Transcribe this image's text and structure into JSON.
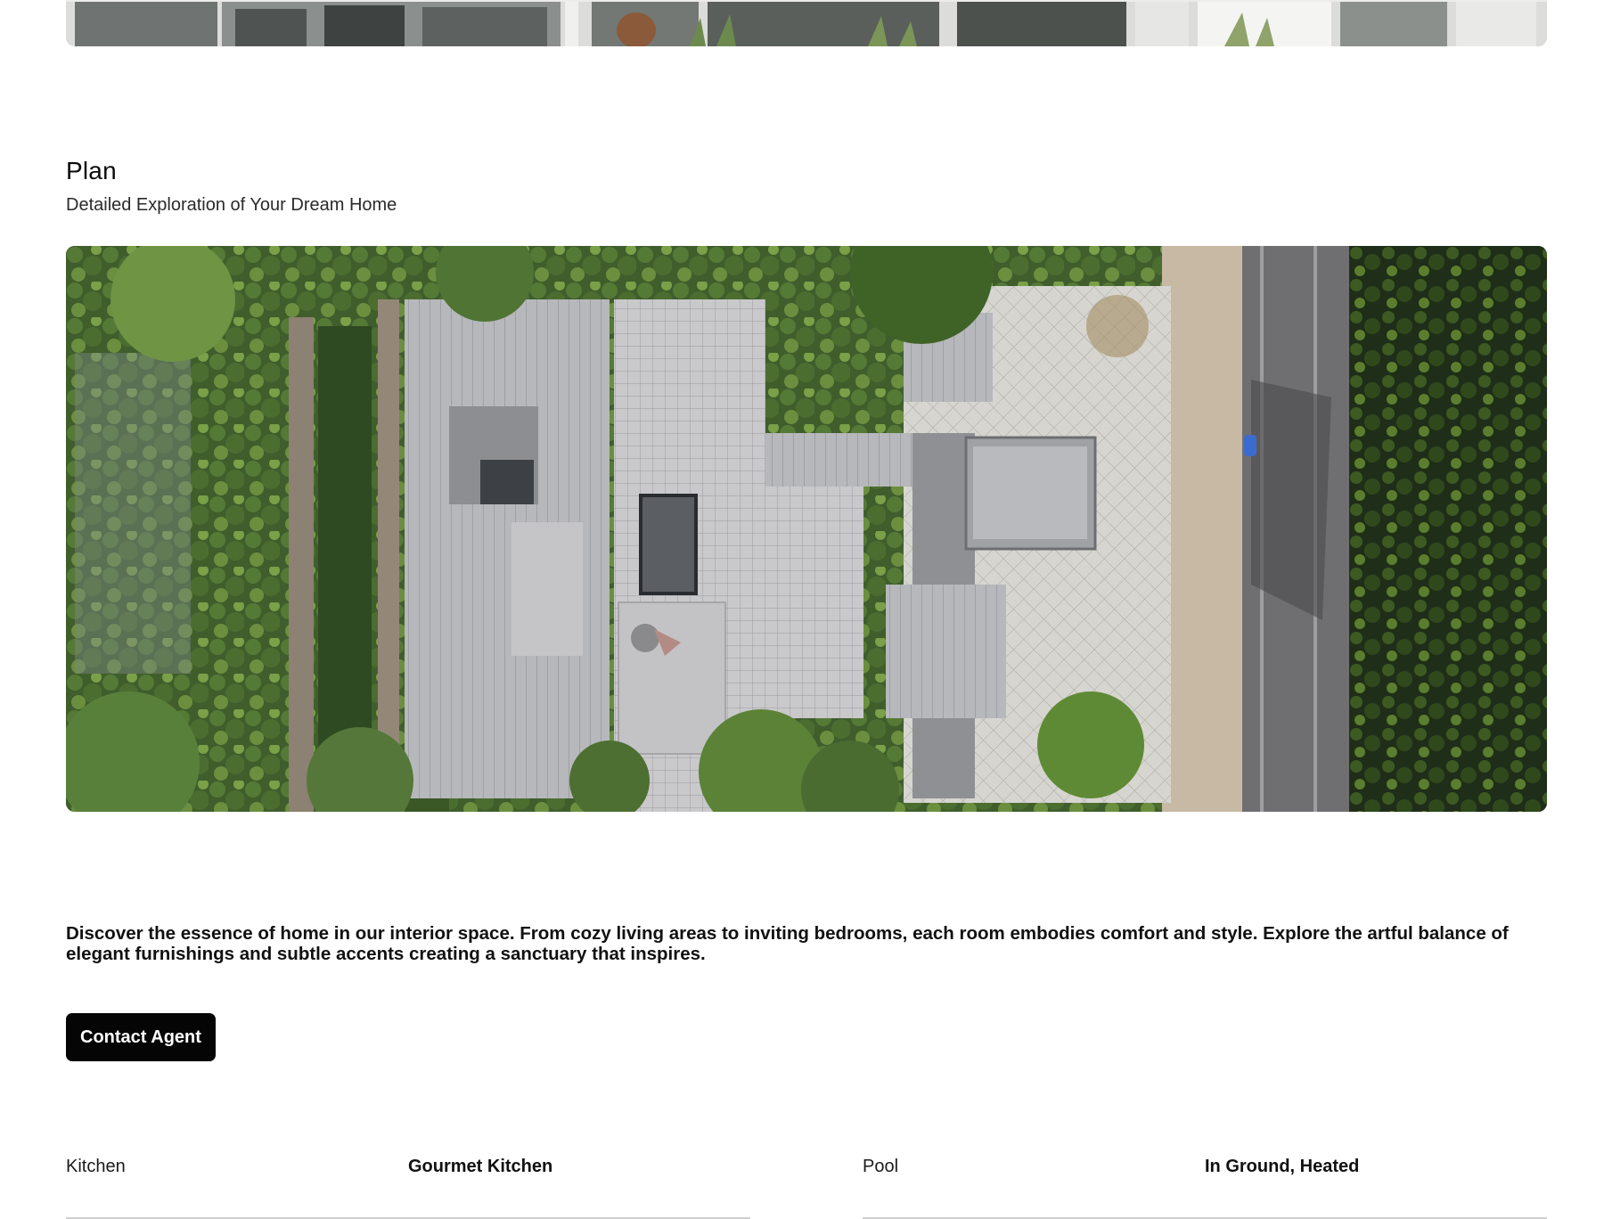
{
  "plan_section": {
    "title": "Plan",
    "subtitle": "Detailed Exploration of Your Dream Home"
  },
  "description": "Discover the essence of home in our interior space. From cozy living areas to inviting bedrooms, each room embodies comfort and style. Explore the artful balance of elegant furnishings and subtle accents creating a sanctuary that inspires.",
  "cta": {
    "contact_label": "Contact Agent"
  },
  "features": [
    {
      "label": "Kitchen",
      "value": "Gourmet Kitchen"
    },
    {
      "label": "Pool",
      "value": "In Ground, Heated"
    }
  ],
  "colors": {
    "button_bg": "#050505",
    "button_text": "#ffffff",
    "divider": "#cfcfcf"
  }
}
